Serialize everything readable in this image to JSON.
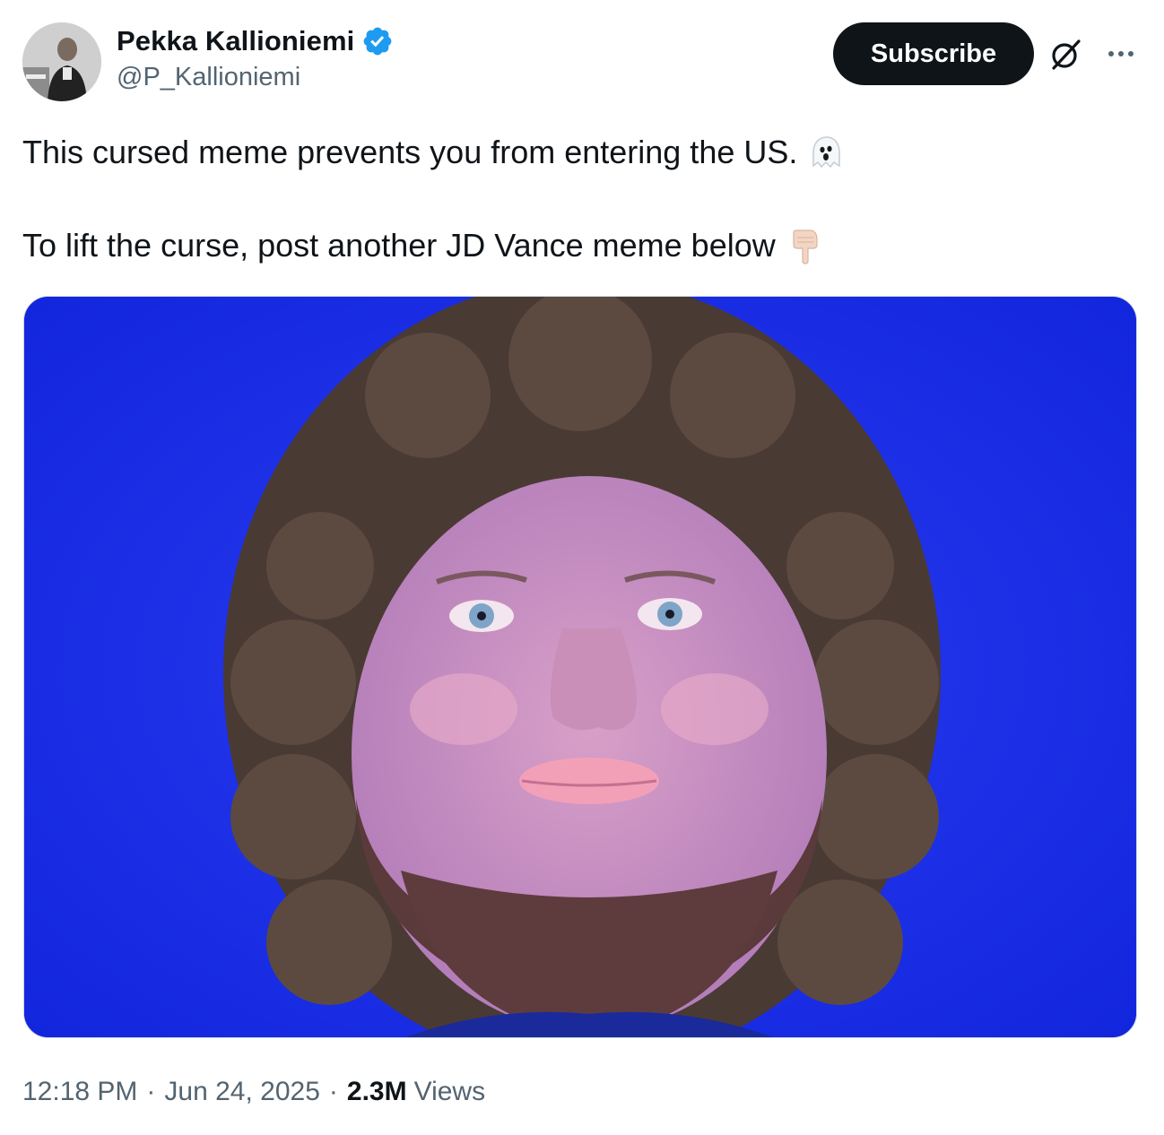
{
  "author": {
    "display_name": "Pekka Kallioniemi",
    "handle": "@P_Kallioniemi",
    "verified": true
  },
  "actions": {
    "subscribe_label": "Subscribe"
  },
  "tweet": {
    "line1": "This cursed meme prevents you from entering the US.",
    "line1_emoji": "ghost-emoji",
    "line2": "To lift the curse, post another JD Vance meme below",
    "line2_emoji": "backhand-index-pointing-down-emoji"
  },
  "media": {
    "kind": "photo",
    "description_icon": "meme-photo"
  },
  "meta": {
    "time": "12:18 PM",
    "separator": "·",
    "date": "Jun 24, 2025",
    "views_count": "2.3M",
    "views_label": "Views"
  },
  "colors": {
    "verified_blue": "#1d9bf0",
    "text_primary": "#0f1419",
    "text_secondary": "#536471",
    "button_bg": "#0f1419",
    "photo_bg": "#1830e8"
  }
}
